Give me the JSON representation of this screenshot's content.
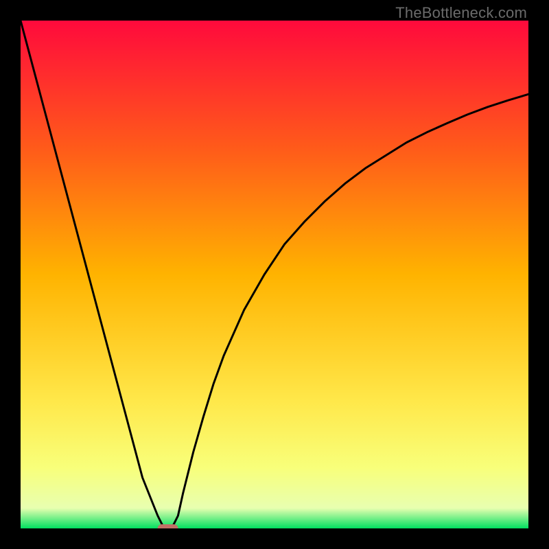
{
  "watermark": "TheBottleneck.com",
  "colors": {
    "gradient_top": "#ff0a3c",
    "gradient_upper_mid": "#ff5a1a",
    "gradient_mid": "#ffb300",
    "gradient_lower_mid": "#ffe84a",
    "gradient_band": "#f8ff7a",
    "gradient_green": "#00e060",
    "curve": "#000000",
    "marker": "#c07066",
    "background": "#000000"
  },
  "chart_data": {
    "type": "line",
    "title": "",
    "xlabel": "",
    "ylabel": "",
    "xlim": [
      0,
      100
    ],
    "ylim": [
      0,
      100
    ],
    "x": [
      0,
      2,
      4,
      6,
      8,
      10,
      12,
      14,
      16,
      18,
      20,
      22,
      24,
      26,
      27,
      28,
      29,
      30,
      31,
      32,
      34,
      36,
      38,
      40,
      44,
      48,
      52,
      56,
      60,
      64,
      68,
      72,
      76,
      80,
      84,
      88,
      92,
      96,
      100
    ],
    "values": [
      100,
      92.5,
      85.0,
      77.5,
      70.0,
      62.5,
      55.0,
      47.5,
      40.0,
      32.5,
      25.0,
      17.5,
      10.0,
      5.0,
      2.5,
      0.5,
      0.0,
      0.5,
      2.5,
      7.0,
      15.0,
      22.0,
      28.5,
      34.0,
      43.0,
      50.0,
      56.0,
      60.5,
      64.5,
      68.0,
      71.0,
      73.5,
      76.0,
      78.0,
      79.8,
      81.5,
      83.0,
      84.3,
      85.5
    ],
    "min_point": {
      "x": 29,
      "y": 0
    },
    "gradient_stops_y": [
      {
        "y": 100,
        "color": "#ff0a3c"
      },
      {
        "y": 75,
        "color": "#ff5a1a"
      },
      {
        "y": 50,
        "color": "#ffb300"
      },
      {
        "y": 25,
        "color": "#ffe84a"
      },
      {
        "y": 12,
        "color": "#f8ff7a"
      },
      {
        "y": 4,
        "color": "#e8ffb0"
      },
      {
        "y": 0,
        "color": "#00e060"
      }
    ]
  }
}
